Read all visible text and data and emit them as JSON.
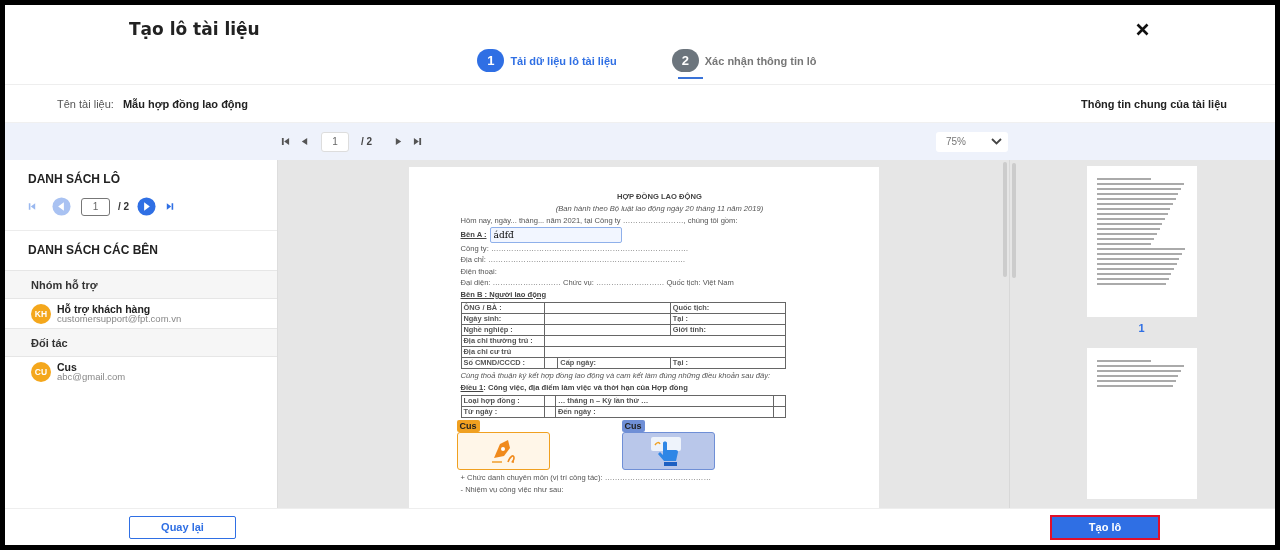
{
  "dialog": {
    "title": "Tạo lô tài liệu"
  },
  "steps": [
    {
      "number": "1",
      "label": "Tải dữ liệu lô tài liệu",
      "selected": true
    },
    {
      "number": "2",
      "label": "Xác nhận thông tin lô",
      "selected": false
    }
  ],
  "document_info": {
    "name_label": "Tên tài liệu:",
    "name": "Mẫu hợp đồng lao động",
    "general_info_link": "Thông tin chung của tài liệu"
  },
  "viewer_toolbar": {
    "page": "1",
    "page_total": "/ 2",
    "zoom": "75%"
  },
  "batch_list": {
    "title": "DANH SÁCH LÔ",
    "page": "1",
    "page_total": "/ 2",
    "prev_disabled": true,
    "next_disabled": false
  },
  "parties": {
    "title": "DANH SÁCH CÁC BÊN",
    "groups": [
      {
        "name": "Nhóm hỗ trợ",
        "members": [
          {
            "initials": "KH",
            "name": "Hỗ trợ khách hàng",
            "email": "customersupport@fpt.com.vn"
          }
        ]
      },
      {
        "name": "Đối tác",
        "members": [
          {
            "initials": "CU",
            "name": "Cus",
            "email": "abc@gmail.com"
          }
        ]
      }
    ]
  },
  "document": {
    "blocks": [
      {
        "kind": "title",
        "text": "HỢP ĐỒNG LAO ĐỘNG"
      },
      {
        "kind": "subtitle",
        "text": "(Ban hành theo Bộ luật lao động ngày 20 tháng 11 năm 2019)"
      },
      {
        "kind": "text",
        "text": "Hôm nay, ngày... tháng... năm 2021, tại Công ty ……………………, chúng tôi gồm:"
      },
      {
        "kind": "field",
        "lead": "Bên A :",
        "value": "ádfđ"
      },
      {
        "kind": "text",
        "text": "Công ty: ……………………………………………………………………"
      },
      {
        "kind": "text",
        "text": "Địa chỉ: ……………………………………………………………………"
      },
      {
        "kind": "text",
        "text": "Điện thoại:"
      },
      {
        "kind": "text",
        "text": "Đại diện: ……………………… Chức vụ: ……………………… Quốc tịch: Việt Nam"
      },
      {
        "kind": "clause",
        "lead": "Bên B : Người lao động"
      },
      {
        "kind": "table",
        "rows": [
          [
            "ÔNG / BÀ :",
            null,
            "Quốc tịch:"
          ],
          [
            "Ngày sinh:",
            null,
            "Tại :"
          ],
          [
            "Nghề nghiệp :",
            null,
            "Giới tính:"
          ],
          [
            "Địa chỉ thường trú :",
            null
          ],
          [
            "Địa chỉ cư trú",
            null
          ],
          [
            "Số CMND/CCCD :",
            null,
            "Cấp ngày:",
            "Tại :"
          ]
        ]
      },
      {
        "kind": "note",
        "text": "Cùng thoả thuận ký kết hợp đồng lao động và cam kết làm đúng những điều khoản sau đây:"
      },
      {
        "kind": "clause",
        "lead": "Điều 1",
        "text": ": Công việc, địa điểm làm việc và thời hạn của Hợp đồng"
      },
      {
        "kind": "table",
        "rows": [
          [
            "Loại hợp đồng :",
            null,
            "… tháng n – Kỳ lần thứ …",
            null
          ],
          [
            "Từ ngày :",
            null,
            "Đến ngày :",
            null
          ]
        ]
      },
      {
        "kind": "signatures",
        "fields": [
          {
            "tag": "Cus",
            "kind": "pen",
            "color": "#f0a020"
          },
          {
            "tag": "Cus",
            "kind": "touch",
            "color": "#6f8fd6"
          }
        ]
      },
      {
        "kind": "text",
        "text": "+ Chức danh chuyên môn (vị trí công tác): ……………………………………"
      },
      {
        "kind": "text",
        "text": "- Nhiệm vụ công việc như sau:"
      }
    ]
  },
  "thumbnails": [
    {
      "kind": "page",
      "label": "1"
    },
    {
      "kind": "page"
    }
  ],
  "footer": {
    "back": "Quay lại",
    "create": "Tạo lô"
  }
}
